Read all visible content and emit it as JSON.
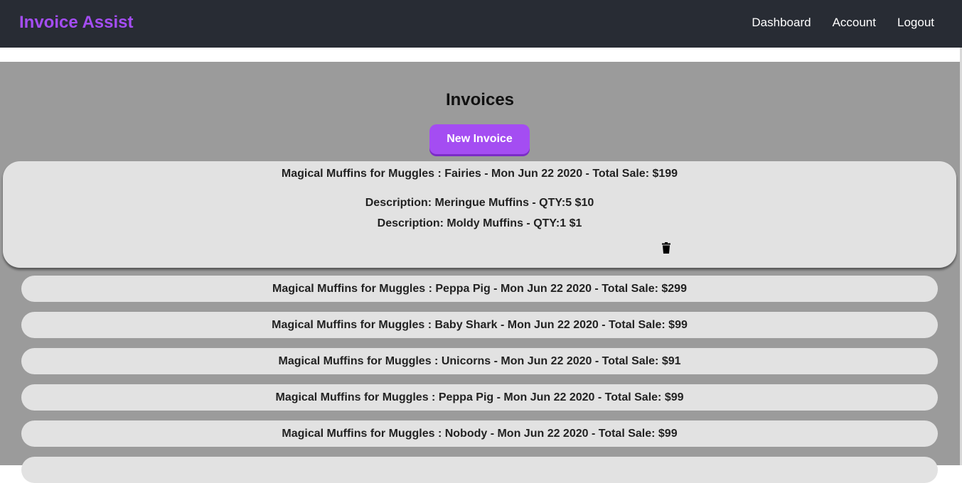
{
  "navbar": {
    "brand": "Invoice Assist",
    "links": [
      "Dashboard",
      "Account",
      "Logout"
    ]
  },
  "main": {
    "title": "Invoices",
    "new_button_label": "New Invoice",
    "expanded_invoice": {
      "title": "Magical Muffins for Muggles : Fairies - Mon Jun 22 2020 - Total Sale: $199",
      "items": [
        "Description: Meringue Muffins - QTY:5 $10",
        "Description: Moldy Muffins - QTY:1 $1"
      ],
      "delete_icon": "trash-icon"
    },
    "invoices": [
      "Magical Muffins for Muggles : Peppa Pig - Mon Jun 22 2020 - Total Sale: $299",
      "Magical Muffins for Muggles : Baby Shark - Mon Jun 22 2020 - Total Sale: $99",
      "Magical Muffins for Muggles : Unicorns - Mon Jun 22 2020 - Total Sale: $91",
      "Magical Muffins for Muggles : Peppa Pig - Mon Jun 22 2020 - Total Sale: $99",
      "Magical Muffins for Muggles : Nobody - Mon Jun 22 2020 - Total Sale: $99"
    ]
  },
  "colors": {
    "navbar_bg": "#282c34",
    "brand": "#a44df2",
    "accent": "#a44df2",
    "main_bg": "#9b9b9b",
    "card_bg": "#e2e2e2"
  }
}
